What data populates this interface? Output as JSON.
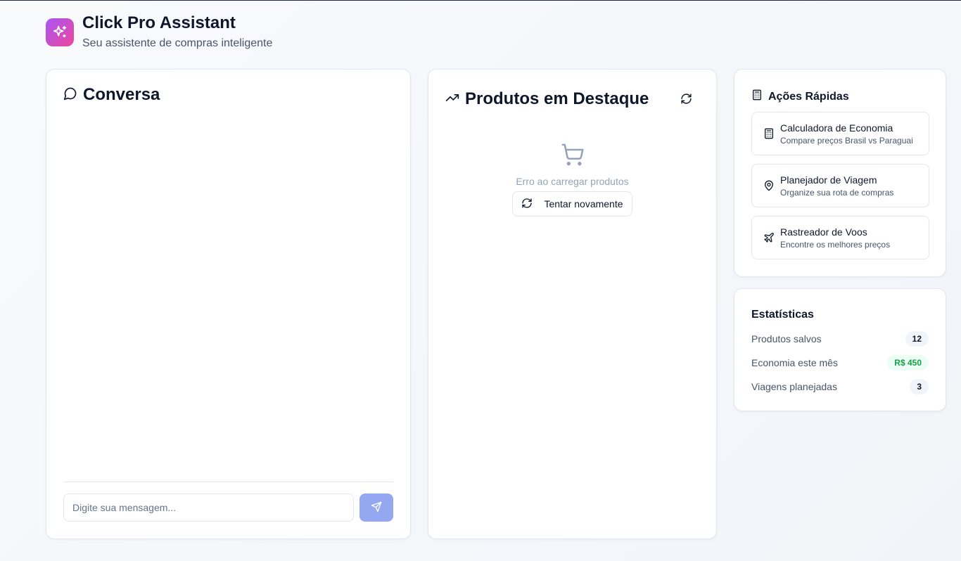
{
  "header": {
    "title": "Click Pro Assistant",
    "subtitle": "Seu assistente de compras inteligente",
    "logo_icon": "sparkles-icon",
    "logo_gradient": [
      "#a855f7",
      "#ec4899"
    ]
  },
  "chat": {
    "title": "Conversa",
    "icon": "message-circle-icon",
    "input_placeholder": "Digite sua mensagem...",
    "input_value": "",
    "send_icon": "send-icon"
  },
  "products": {
    "title": "Produtos em Destaque",
    "icon": "trending-up-icon",
    "refresh_icon": "refresh-icon",
    "empty_icon": "shopping-cart-icon",
    "error_message": "Erro ao carregar produtos",
    "retry_label": "Tentar novamente"
  },
  "quick_actions": {
    "title": "Ações Rápidas",
    "icon": "calculator-icon",
    "items": [
      {
        "name": "Calculadora de Economia",
        "description": "Compare preços Brasil vs Paraguai",
        "icon": "calculator-icon"
      },
      {
        "name": "Planejador de Viagem",
        "description": "Organize sua rota de compras",
        "icon": "map-pin-icon"
      },
      {
        "name": "Rastreador de Voos",
        "description": "Encontre os melhores preços",
        "icon": "plane-icon"
      }
    ]
  },
  "stats": {
    "title": "Estatísticas",
    "items": [
      {
        "label": "Produtos salvos",
        "value": "12"
      },
      {
        "label": "Economia este mês",
        "value": "R$ 450",
        "color": "#16a34a"
      },
      {
        "label": "Viagens planejadas",
        "value": "3"
      }
    ]
  }
}
